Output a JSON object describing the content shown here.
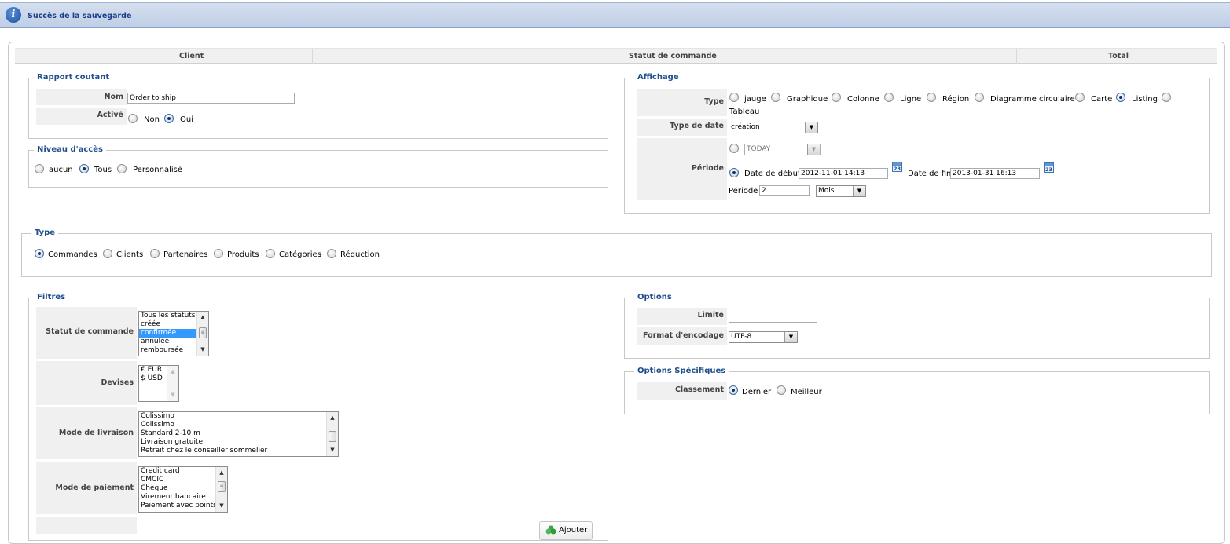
{
  "banner": {
    "icon": "info-icon",
    "text": "Succès de la sauvegarde"
  },
  "columns": [
    "Client",
    "Statut de commande",
    "Total"
  ],
  "rapport": {
    "legend": "Rapport coutant",
    "nom_label": "Nom",
    "nom_value": "Order to ship",
    "active_label": "Activé",
    "non": "Non",
    "oui": "Oui",
    "active_selected": "Oui"
  },
  "acces": {
    "legend": "Niveau d'accès",
    "options": [
      "aucun",
      "Tous",
      "Personnalisé"
    ],
    "selected": "Tous"
  },
  "affichage": {
    "legend": "Affichage",
    "type_label": "Type",
    "types": [
      "jauge",
      "Graphique",
      "Colonne",
      "Ligne",
      "Région",
      "Diagramme circulaire",
      "Carte",
      "Listing",
      "Tableau"
    ],
    "type_selected": "Listing",
    "type_date_label": "Type de date",
    "type_date_value": "création",
    "periode_label": "Période",
    "today_value": "TODAY",
    "date_debut_label": "Date de début",
    "date_debut_value": "2012-11-01 14:13",
    "date_fin_label": "Date de fin",
    "date_fin_value": "2013-01-31 16:13",
    "calendar_icon_text": "23",
    "periode_inline_label": "Période",
    "periode_value": "2",
    "periode_unit": "Mois"
  },
  "type": {
    "legend": "Type",
    "options": [
      "Commandes",
      "Clients",
      "Partenaires",
      "Produits",
      "Catégories",
      "Réduction"
    ],
    "selected": "Commandes"
  },
  "filtres": {
    "legend": "Filtres",
    "statut_label": "Statut de commande",
    "statut_options": [
      "Tous les statuts",
      "créée",
      "confirmée",
      "annulée",
      "remboursée"
    ],
    "statut_selected": "confirmée",
    "devises_label": "Devises",
    "devises_options": [
      "€ EUR",
      "$ USD"
    ],
    "livraison_label": "Mode de livraison",
    "livraison_options": [
      "Colissimo",
      "Colissimo",
      "Standard 2-10 m",
      "Livraison gratuite",
      "Retrait chez le conseiller sommelier"
    ],
    "paiement_label": "Mode de paiement",
    "paiement_options": [
      "Credit card",
      "CMCIC",
      "Chèque",
      "Virement bancaire",
      "Paiement avec points"
    ],
    "add_button": "Ajouter"
  },
  "options": {
    "legend": "Options",
    "limite_label": "Limite",
    "limite_value": "",
    "encodage_label": "Format d'encodage",
    "encodage_value": "UTF-8"
  },
  "options_specifiques": {
    "legend": "Options Spécifiques",
    "classement_label": "Classement",
    "dernier": "Dernier",
    "meilleur": "Meilleur",
    "selected": "Dernier"
  }
}
